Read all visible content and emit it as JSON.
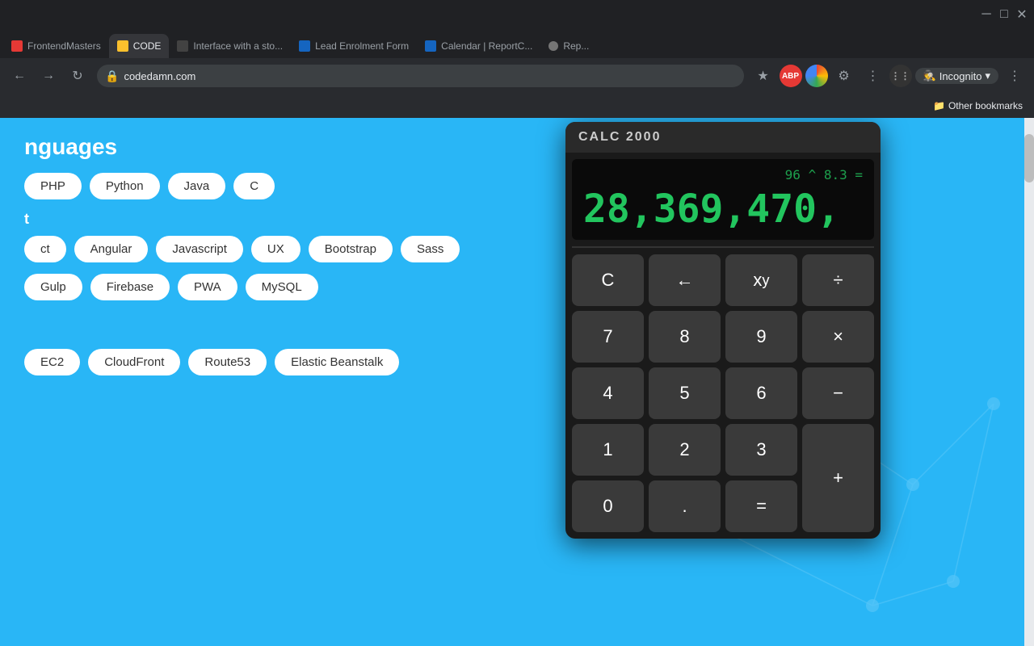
{
  "browser": {
    "window_controls": [
      "─",
      "□",
      "✕"
    ],
    "toolbar": {
      "back": "←",
      "forward": "→",
      "refresh": "↻",
      "home": "⌂",
      "extensions_icon": "⋮",
      "incognito_label": "Incognito",
      "incognito_menu": "⋮"
    },
    "tabs": [
      {
        "label": "FrontendMasters",
        "favicon_color": "#e53935",
        "active": false
      },
      {
        "label": "CODE",
        "favicon_color": "#fbc02d",
        "active": false
      },
      {
        "label": "Interface with a sto...",
        "favicon_color": "#424242",
        "active": false
      },
      {
        "label": "Lead Enrolment Form",
        "favicon_color": "#1565c0",
        "active": false
      },
      {
        "label": "Calendar | ReportC...",
        "favicon_color": "#1565c0",
        "active": false
      },
      {
        "label": "Rep...",
        "favicon_color": "#757575",
        "active": false
      }
    ],
    "bookmarks": [
      {
        "label": "Other bookmarks"
      }
    ]
  },
  "page": {
    "background_color": "#29b6f6",
    "sections": [
      {
        "heading": "nguages",
        "tags": [
          "PHP",
          "Python",
          "Java",
          "C"
        ]
      },
      {
        "heading": "t",
        "tags": [
          "ct",
          "Angular",
          "Javascript",
          "UX",
          "Bootstrap",
          "Sass"
        ]
      },
      {
        "heading": "",
        "tags": [
          "Gulp",
          "Firebase",
          "PWA",
          "MySQL"
        ]
      },
      {
        "heading": "",
        "tags": [
          "EC2",
          "CloudFront",
          "Route53",
          "Elastic Beanstalk"
        ]
      }
    ]
  },
  "calculator": {
    "title": "CALC 2000",
    "expression": "96 ^ 8.3 =",
    "result": "28,369,470,",
    "buttons": [
      {
        "label": "C",
        "type": "dark"
      },
      {
        "label": "←",
        "type": "dark"
      },
      {
        "label": "xʸ",
        "type": "dark"
      },
      {
        "label": "÷",
        "type": "dark"
      },
      {
        "label": "7",
        "type": "dark"
      },
      {
        "label": "8",
        "type": "dark"
      },
      {
        "label": "9",
        "type": "dark"
      },
      {
        "label": "×",
        "type": "dark"
      },
      {
        "label": "4",
        "type": "dark"
      },
      {
        "label": "5",
        "type": "dark"
      },
      {
        "label": "6",
        "type": "dark"
      },
      {
        "label": "−",
        "type": "dark"
      },
      {
        "label": "1",
        "type": "dark"
      },
      {
        "label": "2",
        "type": "dark"
      },
      {
        "label": "3",
        "type": "dark"
      },
      {
        "label": "+",
        "type": "dark",
        "span2": true
      },
      {
        "label": "0",
        "type": "dark"
      },
      {
        "label": ".",
        "type": "dark"
      },
      {
        "label": "=",
        "type": "dark"
      }
    ]
  }
}
